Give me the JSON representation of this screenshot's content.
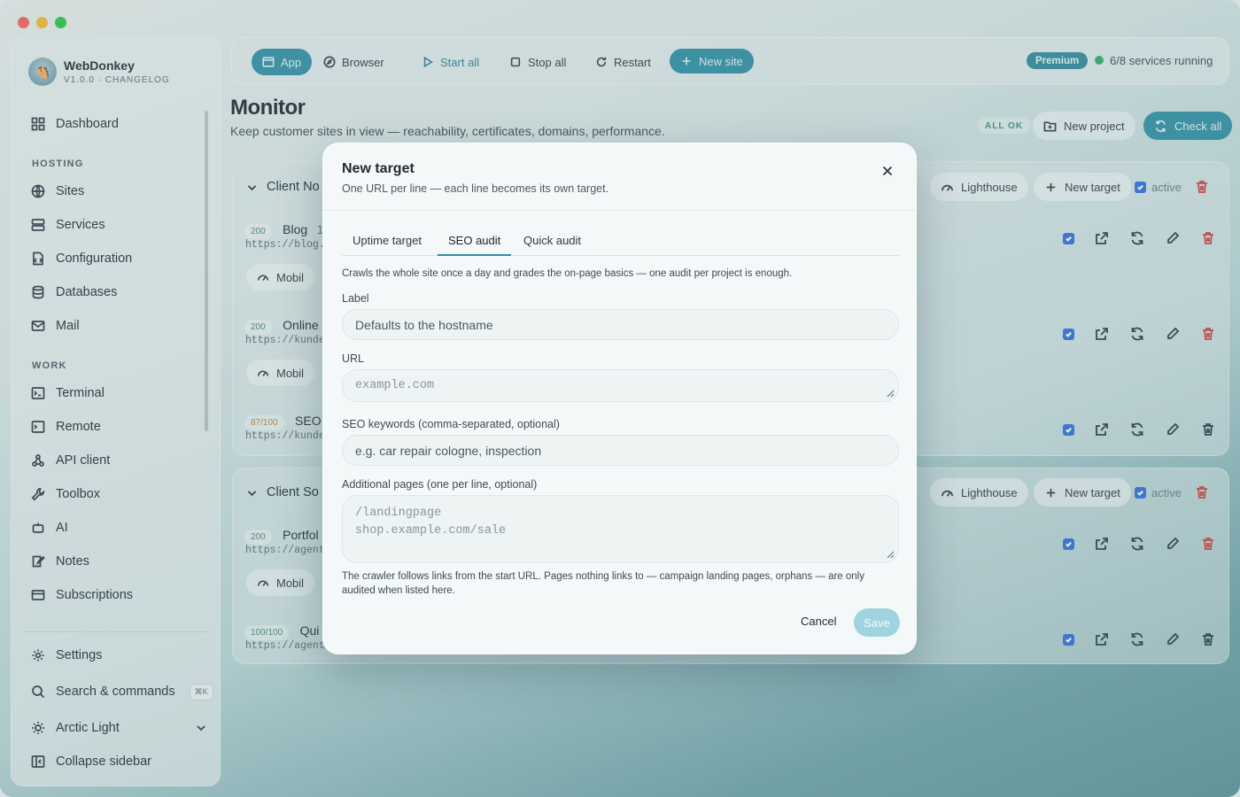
{
  "brand": {
    "name": "WebDonkey",
    "version": "V1.0.0 · CHANGELOG"
  },
  "sidebar": {
    "dashboard": "Dashboard",
    "sections": [
      {
        "label": "HOSTING"
      },
      {
        "label": "WORK"
      }
    ],
    "hosting": [
      {
        "label": "Sites",
        "icon": "globe-icon"
      },
      {
        "label": "Services",
        "icon": "server-icon"
      },
      {
        "label": "Configuration",
        "icon": "config-icon"
      },
      {
        "label": "Databases",
        "icon": "database-icon"
      },
      {
        "label": "Mail",
        "icon": "mail-icon"
      }
    ],
    "work": [
      {
        "label": "Terminal",
        "icon": "terminal-icon"
      },
      {
        "label": "Remote",
        "icon": "remote-icon"
      },
      {
        "label": "API client",
        "icon": "api-icon"
      },
      {
        "label": "Toolbox",
        "icon": "wrench-icon"
      },
      {
        "label": "AI",
        "icon": "robot-icon"
      },
      {
        "label": "Notes",
        "icon": "notes-icon"
      },
      {
        "label": "Subscriptions",
        "icon": "card-icon"
      }
    ],
    "settings": "Settings",
    "search": "Search & commands",
    "search_shortcut": "⌘K",
    "theme": "Arctic Light",
    "collapse": "Collapse sidebar"
  },
  "toolbar": {
    "app": "App",
    "browser": "Browser",
    "start_all": "Start all",
    "stop_all": "Stop all",
    "restart": "Restart",
    "new_site": "New site",
    "premium": "Premium",
    "services": "6/8 services running"
  },
  "page": {
    "title": "Monitor",
    "subtitle": "Keep customer sites in view — reachability, certificates, domains, performance.",
    "all_ok": "ALL OK",
    "new_project": "New project",
    "check_all": "Check all"
  },
  "projects": [
    {
      "name": "Client No",
      "lighthouse": "Lighthouse",
      "new_target": "New target",
      "active": "active",
      "rows": [
        {
          "code": "200",
          "title": "Blog",
          "suffix": "1",
          "url": "https://blog.",
          "chip": "Mobil"
        },
        {
          "code": "200",
          "title": "Online",
          "url": "https://kunde",
          "chip": "Mobil"
        },
        {
          "code": "87/100",
          "title": "SEO",
          "url": "https://kunde"
        }
      ]
    },
    {
      "name": "Client So",
      "lighthouse": "Lighthouse",
      "new_target": "New target",
      "active": "active",
      "rows": [
        {
          "code": "200",
          "title": "Portfol",
          "url": "https://agent",
          "chip": "Mobil"
        },
        {
          "code": "100/100",
          "title": "Qui",
          "url": "https://agentu"
        }
      ]
    }
  ],
  "modal": {
    "title": "New target",
    "subtitle": "One URL per line — each line becomes its own target.",
    "tabs": [
      "Uptime target",
      "SEO audit",
      "Quick audit"
    ],
    "active_tab": "SEO audit",
    "description": "Crawls the whole site once a day and grades the on-page basics — one audit per project is enough.",
    "label_label": "Label",
    "label_placeholder": "Defaults to the hostname",
    "url_label": "URL",
    "url_placeholder": "example.com",
    "keywords_label": "SEO keywords (comma-separated, optional)",
    "keywords_placeholder": "e.g. car repair cologne, inspection",
    "pages_label": "Additional pages (one per line, optional)",
    "pages_placeholder_1": "/landingpage",
    "pages_placeholder_2": "shop.example.com/sale",
    "help": "The crawler follows links from the start URL. Pages nothing links to — campaign landing pages, orphans — are only audited when listed here.",
    "cancel": "Cancel",
    "save": "Save"
  },
  "colors": {
    "accent": "#2f8fa6",
    "danger": "#d23b3b",
    "ok": "#2eae6a",
    "checkbox": "#2f6ddf"
  }
}
